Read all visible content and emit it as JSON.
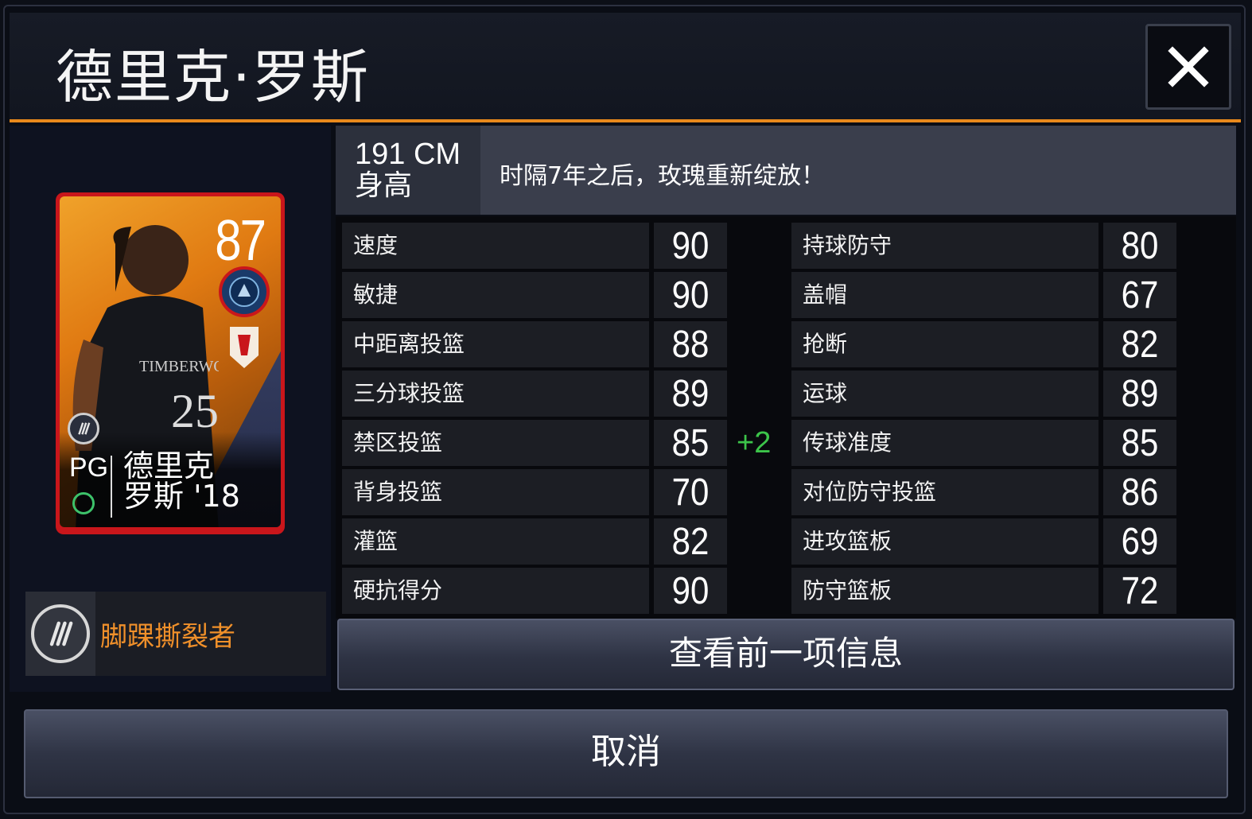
{
  "header": {
    "title": "德里克·罗斯"
  },
  "card": {
    "rating": "87",
    "position": "PG",
    "name_line1": "德里克",
    "name_line2": "罗斯 '18"
  },
  "ability": {
    "name": "脚踝撕裂者"
  },
  "info": {
    "height_value": "191 CM",
    "height_label": "身高",
    "bio": "时隔7年之后，玫瑰重新绽放！"
  },
  "stats_left": [
    {
      "label": "速度",
      "value": "90"
    },
    {
      "label": "敏捷",
      "value": "90"
    },
    {
      "label": "中距离投篮",
      "value": "88"
    },
    {
      "label": "三分球投篮",
      "value": "89"
    },
    {
      "label": "禁区投篮",
      "value": "85"
    },
    {
      "label": "背身投篮",
      "value": "70"
    },
    {
      "label": "灌篮",
      "value": "82"
    },
    {
      "label": "硬抗得分",
      "value": "90"
    }
  ],
  "stats_right": [
    {
      "label": "持球防守",
      "value": "80"
    },
    {
      "label": "盖帽",
      "value": "67"
    },
    {
      "label": "抢断",
      "value": "82"
    },
    {
      "label": "运球",
      "value": "89"
    },
    {
      "label": "传球准度",
      "value": "85"
    },
    {
      "label": "对位防守投篮",
      "value": "86"
    },
    {
      "label": "进攻篮板",
      "value": "69"
    },
    {
      "label": "防守篮板",
      "value": "72"
    }
  ],
  "bonus": "+2",
  "buttons": {
    "previous": "查看前一项信息",
    "cancel": "取消"
  },
  "colors": {
    "accent": "#e8891c",
    "ability_text": "#f0902a",
    "bonus": "#3cc44a",
    "card_border": "#c9161b"
  },
  "icons": {
    "close": "close-icon",
    "team": "timberwolves-logo-icon",
    "ability": "claw-marks-icon",
    "tier": "tier-badge-icon"
  }
}
